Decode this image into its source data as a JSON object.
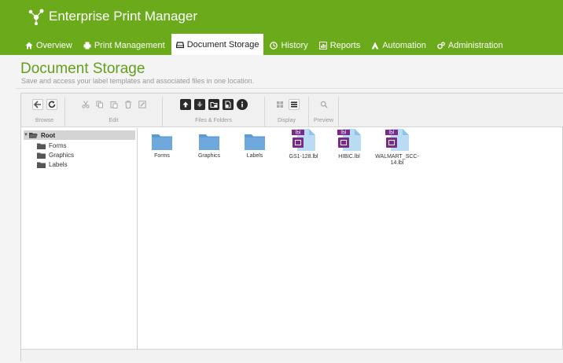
{
  "app": {
    "title": "Enterprise Print Manager",
    "accent": "#6aaa1b"
  },
  "nav": [
    {
      "label": "Overview",
      "icon": "home-icon"
    },
    {
      "label": "Print Management",
      "icon": "printer-icon"
    },
    {
      "label": "Document Storage",
      "icon": "drive-icon",
      "active": true
    },
    {
      "label": "History",
      "icon": "clock-icon"
    },
    {
      "label": "Reports",
      "icon": "chart-icon"
    },
    {
      "label": "Automation",
      "icon": "automation-icon"
    },
    {
      "label": "Administration",
      "icon": "gears-icon"
    }
  ],
  "page": {
    "title": "Document Storage",
    "subtitle": "Save and access your label templates and associated files in one location."
  },
  "toolbar": {
    "groups": [
      {
        "label": "Browse",
        "buttons": [
          "back-icon",
          "refresh-icon"
        ]
      },
      {
        "label": "Edit",
        "buttons": [
          "cut-icon",
          "copy-icon",
          "paste-icon",
          "delete-icon",
          "rename-icon"
        ]
      },
      {
        "label": "Files & Folders",
        "buttons": [
          "upload-icon",
          "download-icon",
          "new-folder-icon",
          "new-file-icon",
          "info-icon"
        ]
      },
      {
        "label": "Display",
        "buttons": [
          "grid-view-icon",
          "list-view-icon"
        ]
      },
      {
        "label": "Preview",
        "buttons": [
          "search-icon"
        ]
      }
    ]
  },
  "tree": {
    "root": "Root",
    "children": [
      "Forms",
      "Graphics",
      "Labels"
    ]
  },
  "files": [
    {
      "name": "Forms",
      "type": "folder"
    },
    {
      "name": "Graphics",
      "type": "folder"
    },
    {
      "name": "Labels",
      "type": "folder"
    },
    {
      "name": "GS1-128.lbl",
      "type": "label",
      "badge": "lbl"
    },
    {
      "name": "HIBIC.lbl",
      "type": "label",
      "badge": "lbl"
    },
    {
      "name": "WALMART_SCC-14.lbl",
      "type": "label",
      "badge": "lbl"
    }
  ]
}
